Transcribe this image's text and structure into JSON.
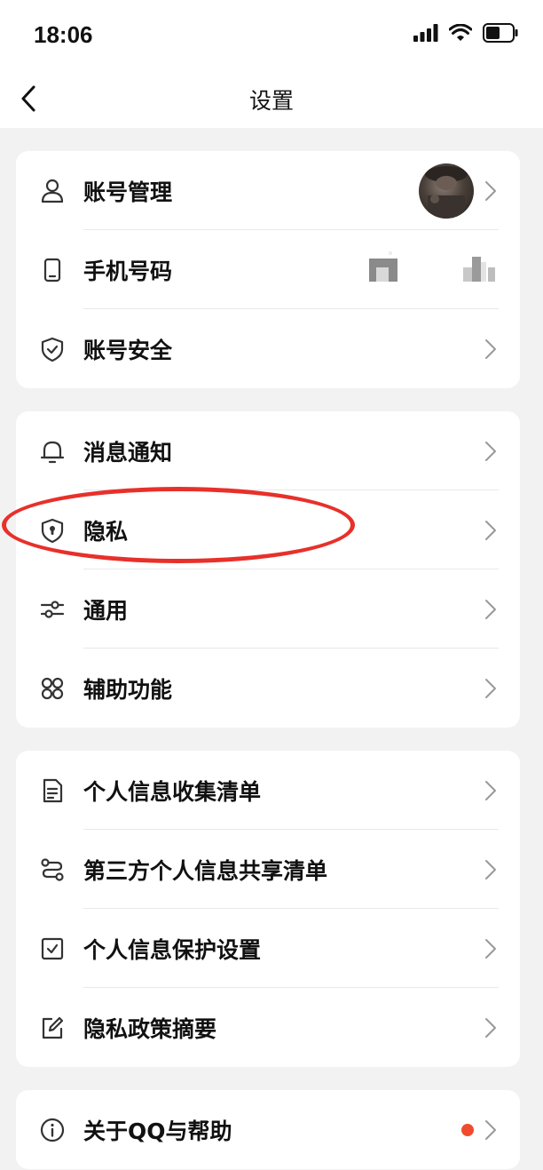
{
  "status_bar": {
    "time": "18:06"
  },
  "navbar": {
    "title": "设置"
  },
  "groups": [
    {
      "items": [
        {
          "label": "账号管理",
          "icon": "user-icon"
        },
        {
          "label": "手机号码",
          "icon": "phone-icon"
        },
        {
          "label": "账号安全",
          "icon": "shield-check-icon"
        }
      ]
    },
    {
      "items": [
        {
          "label": "消息通知",
          "icon": "bell-icon"
        },
        {
          "label": "隐私",
          "icon": "privacy-shield-icon"
        },
        {
          "label": "通用",
          "icon": "sliders-icon"
        },
        {
          "label": "辅助功能",
          "icon": "grid-icon"
        }
      ]
    },
    {
      "items": [
        {
          "label": "个人信息收集清单",
          "icon": "document-icon"
        },
        {
          "label": "第三方个人信息共享清单",
          "icon": "share-icon"
        },
        {
          "label": "个人信息保护设置",
          "icon": "checkbox-icon"
        },
        {
          "label": "隐私政策摘要",
          "icon": "edit-icon"
        }
      ]
    },
    {
      "items": [
        {
          "label": "关于QQ与帮助",
          "icon": "info-icon"
        }
      ]
    }
  ],
  "colors": {
    "annotation": "#e8302a",
    "badge": "#f04b2e",
    "background": "#f2f2f2"
  }
}
